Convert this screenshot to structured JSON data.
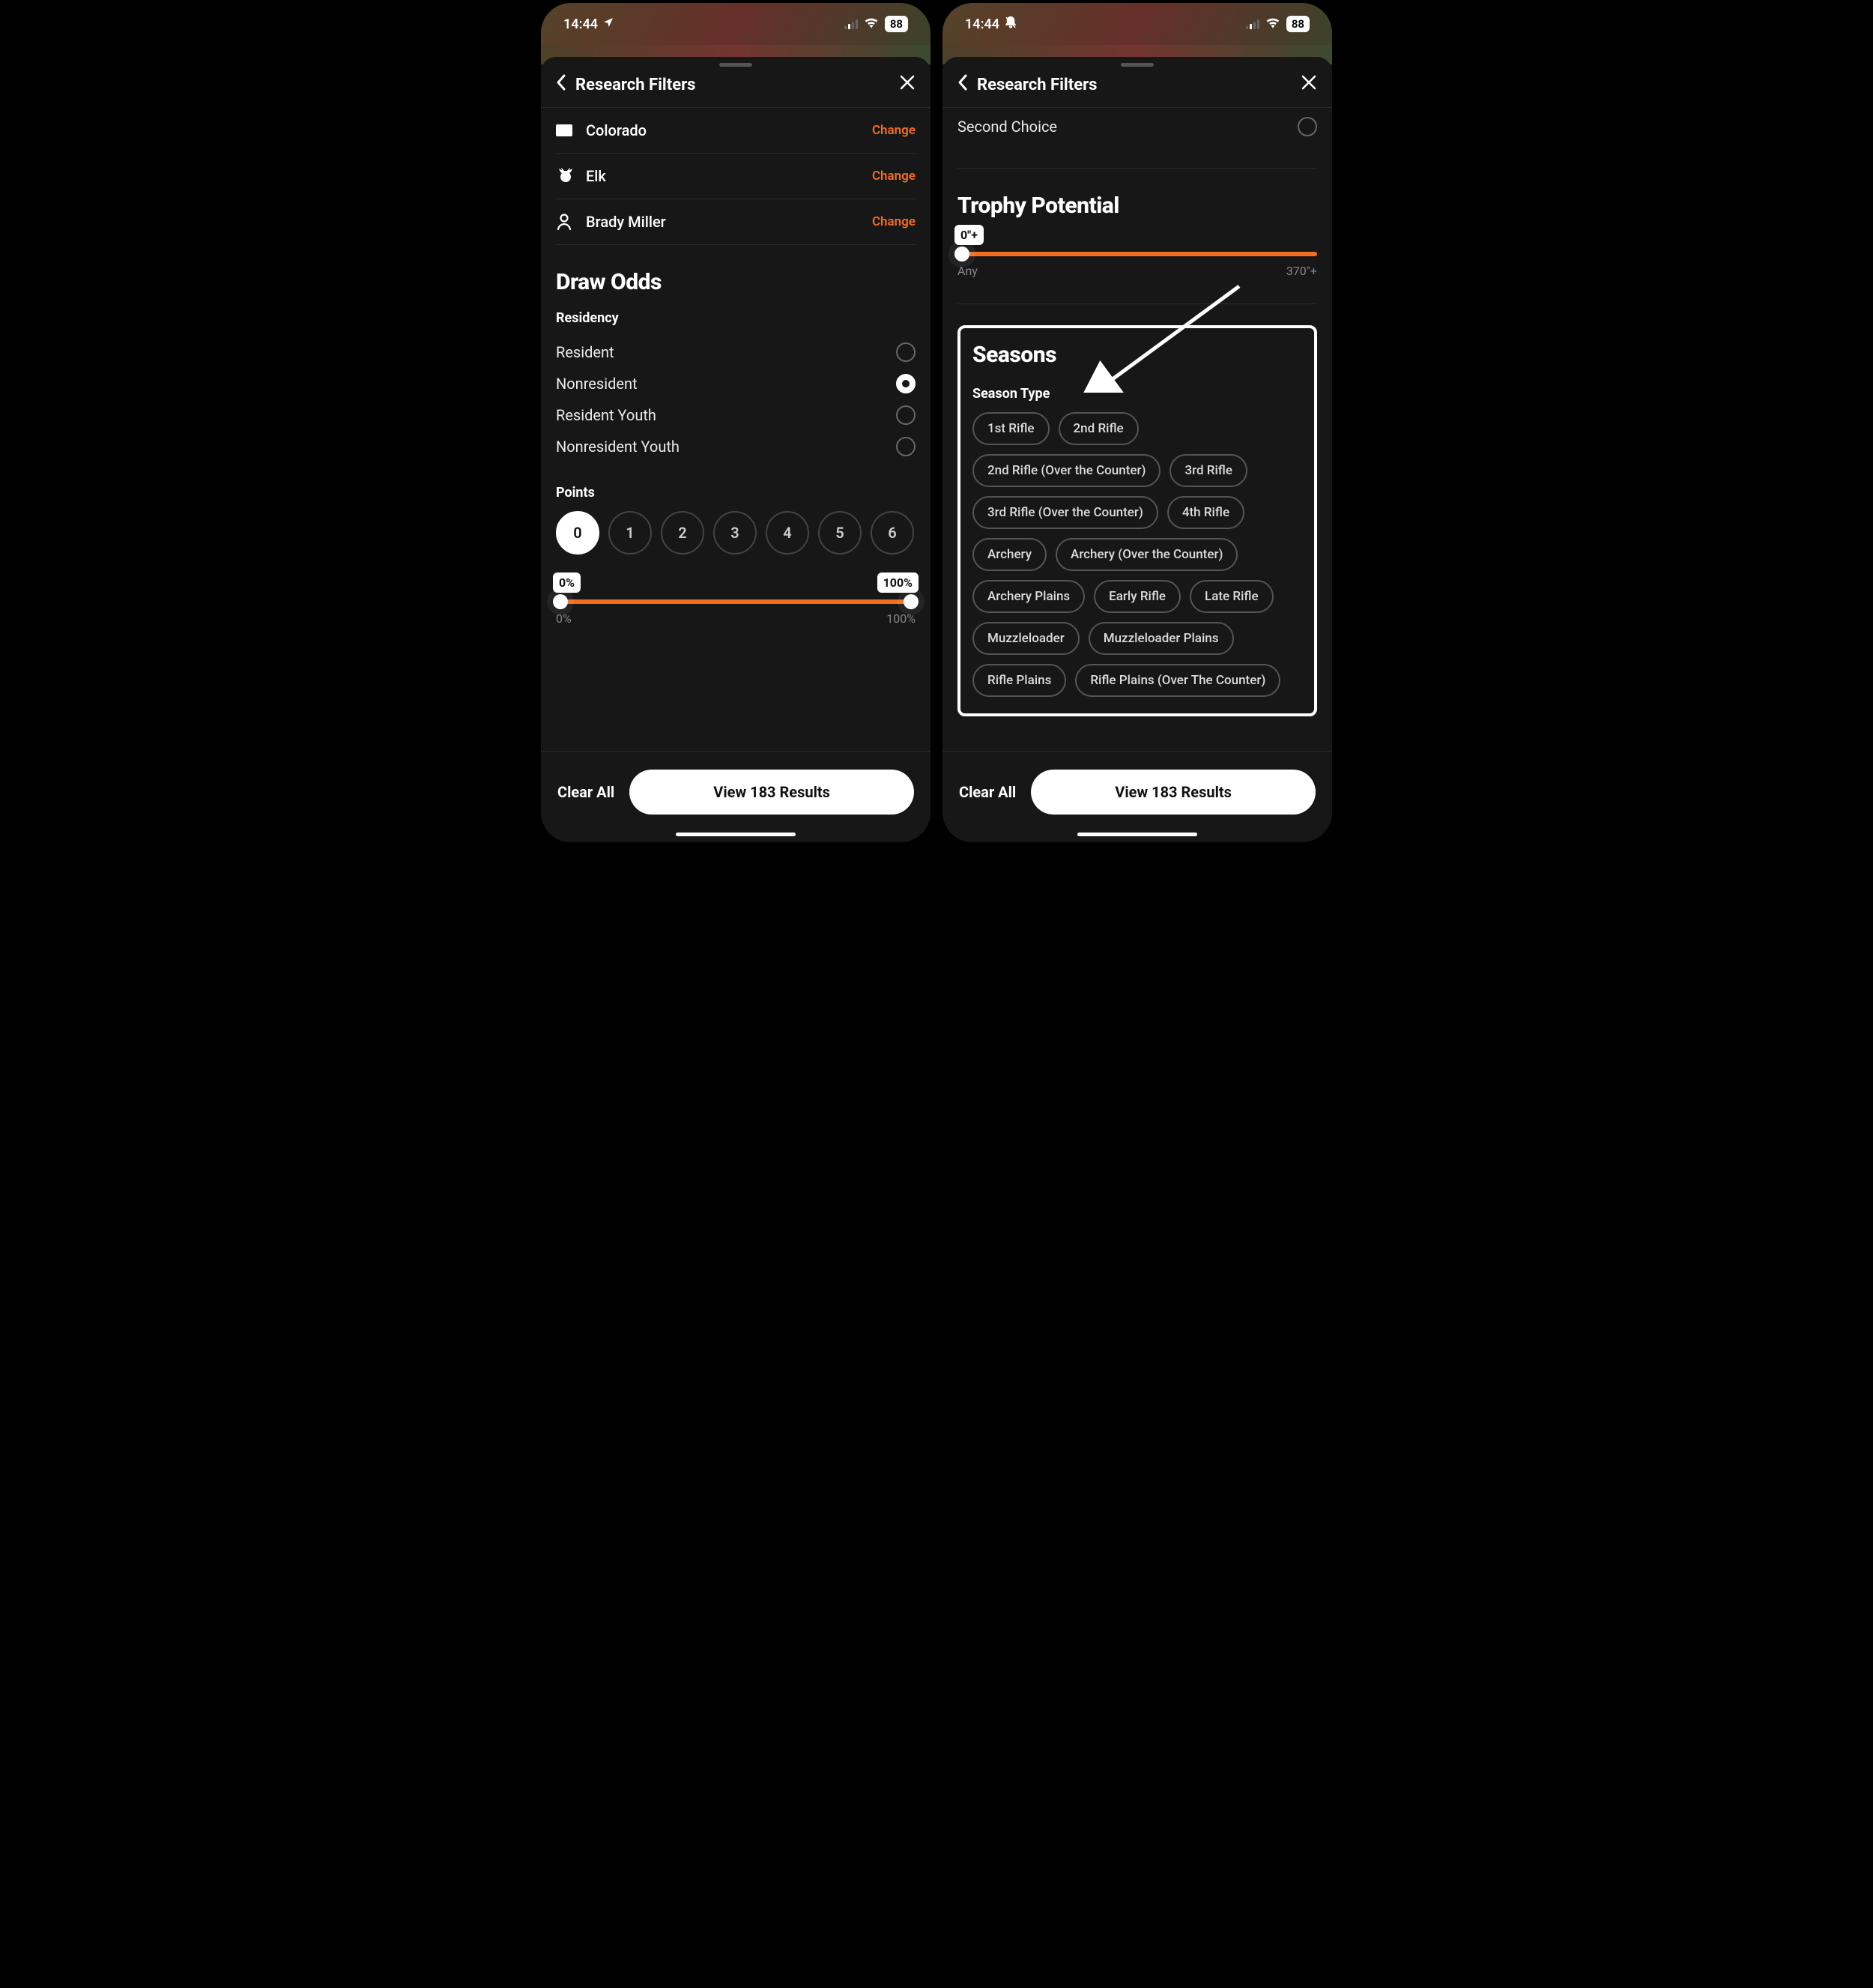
{
  "status": {
    "time": "14:44",
    "battery": "88"
  },
  "sheet": {
    "title": "Research Filters",
    "change": "Change",
    "state": "Colorado",
    "species": "Elk",
    "user": "Brady Miller"
  },
  "drawOdds": {
    "title": "Draw Odds",
    "residencyLabel": "Residency",
    "residency": [
      {
        "label": "Resident",
        "selected": false
      },
      {
        "label": "Nonresident",
        "selected": true
      },
      {
        "label": "Resident Youth",
        "selected": false
      },
      {
        "label": "Nonresident Youth",
        "selected": false
      }
    ],
    "pointsLabel": "Points",
    "points": [
      "0",
      "1",
      "2",
      "3",
      "4",
      "5",
      "6"
    ],
    "pointsSelected": "0",
    "range": {
      "minBadge": "0%",
      "maxBadge": "100%",
      "minLabel": "0%",
      "maxLabel": "100%"
    }
  },
  "right": {
    "secondChoice": "Second Choice",
    "trophyTitle": "Trophy Potential",
    "trophyBadge": "0\"+",
    "trophyMin": "Any",
    "trophyMax": "370\"+",
    "seasonsTitle": "Seasons",
    "seasonTypeLabel": "Season Type",
    "seasonTypes": [
      "1st Rifle",
      "2nd Rifle",
      "2nd Rifle (Over the Counter)",
      "3rd Rifle",
      "3rd Rifle (Over the Counter)",
      "4th Rifle",
      "Archery",
      "Archery (Over the Counter)",
      "Archery Plains",
      "Early Rifle",
      "Late Rifle",
      "Muzzleloader",
      "Muzzleloader Plains",
      "Rifle Plains",
      "Rifle Plains (Over The Counter)"
    ]
  },
  "footer": {
    "clear": "Clear All",
    "view": "View 183 Results"
  }
}
